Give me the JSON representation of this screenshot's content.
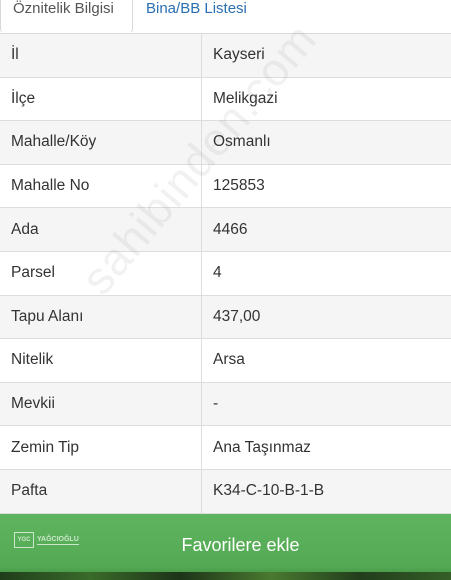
{
  "tabs": [
    {
      "label": "Öznitelik Bilgisi",
      "active": true
    },
    {
      "label": "Bina/BB Listesi",
      "active": false
    }
  ],
  "rows": [
    {
      "label": "İl",
      "value": "Kayseri"
    },
    {
      "label": "İlçe",
      "value": "Melikgazi"
    },
    {
      "label": "Mahalle/Köy",
      "value": "Osmanlı"
    },
    {
      "label": "Mahalle No",
      "value": "125853"
    },
    {
      "label": "Ada",
      "value": "4466"
    },
    {
      "label": "Parsel",
      "value": "4"
    },
    {
      "label": "Tapu Alanı",
      "value": "437,00"
    },
    {
      "label": "Nitelik",
      "value": "Arsa"
    },
    {
      "label": "Mevkii",
      "value": "-"
    },
    {
      "label": "Zemin Tip",
      "value": "Ana Taşınmaz"
    },
    {
      "label": "Pafta",
      "value": "K34-C-10-B-1-B"
    }
  ],
  "watermark": "sahibinden.com"
}
